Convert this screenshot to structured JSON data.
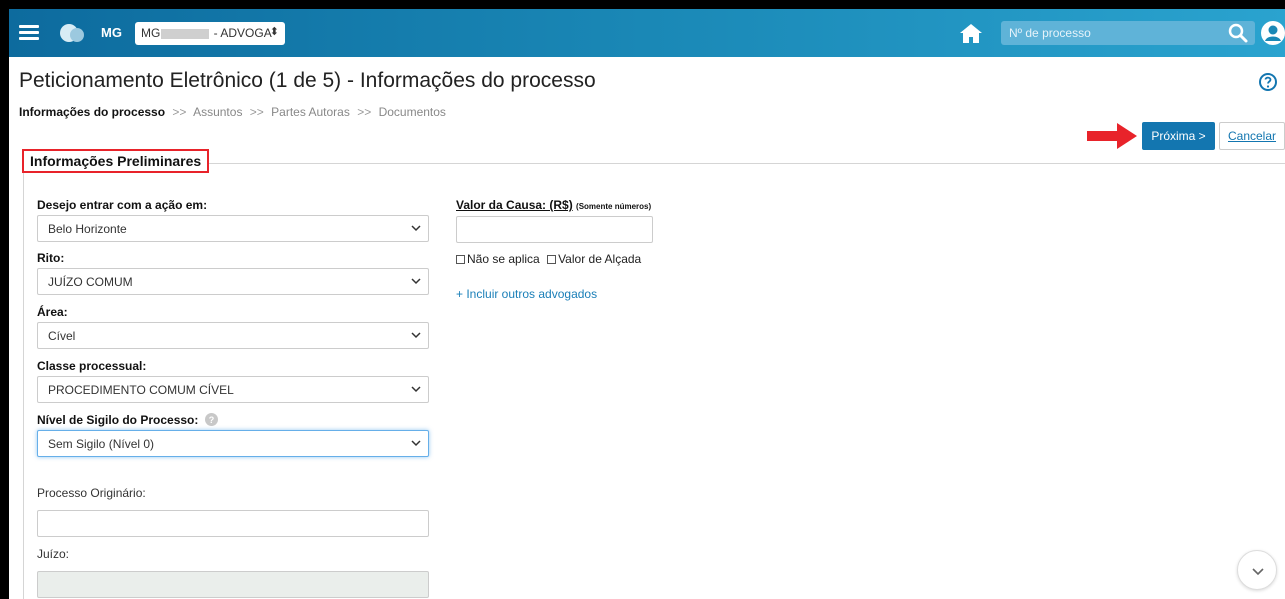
{
  "header": {
    "state": "MG",
    "profile_prefix": "MG",
    "profile_suffix": " - ADVOGA",
    "profile_caret": "⬍",
    "search_placeholder": "Nº de processo"
  },
  "page": {
    "title": "Peticionamento Eletrônico (1 de 5) - Informações do processo"
  },
  "breadcrumb": {
    "items": [
      "Informações do processo",
      "Assuntos",
      "Partes Autoras",
      "Documentos"
    ],
    "separator": ">>"
  },
  "actions": {
    "next_label": "Próxima >",
    "cancel_label": "Cancelar"
  },
  "form": {
    "section_title": "Informações Preliminares",
    "comarca": {
      "label": "Desejo entrar com a ação em:",
      "value": "Belo Horizonte"
    },
    "rito": {
      "label": "Rito:",
      "value": "JUÍZO COMUM"
    },
    "area": {
      "label": "Área:",
      "value": "Cível"
    },
    "classe": {
      "label": "Classe processual:",
      "value": "PROCEDIMENTO COMUM CÍVEL"
    },
    "sigilo": {
      "label": "Nível de Sigilo do Processo:",
      "value": "Sem Sigilo (Nível 0)"
    },
    "processo_originario": {
      "label": "Processo Originário:",
      "value": ""
    },
    "juizo": {
      "label": "Juízo:",
      "value": ""
    },
    "valor_causa": {
      "label": "Valor da Causa: (R$)",
      "note": "(Somente números)",
      "value": ""
    },
    "nao_se_aplica": "Não se aplica",
    "valor_alcada": "Valor de Alçada",
    "incluir_advogados": "+ Incluir outros advogados"
  },
  "colors": {
    "header_start": "#0d6b9e",
    "header_end": "#2aa3cf",
    "primary": "#1376b0",
    "annotation": "#e8232a"
  }
}
